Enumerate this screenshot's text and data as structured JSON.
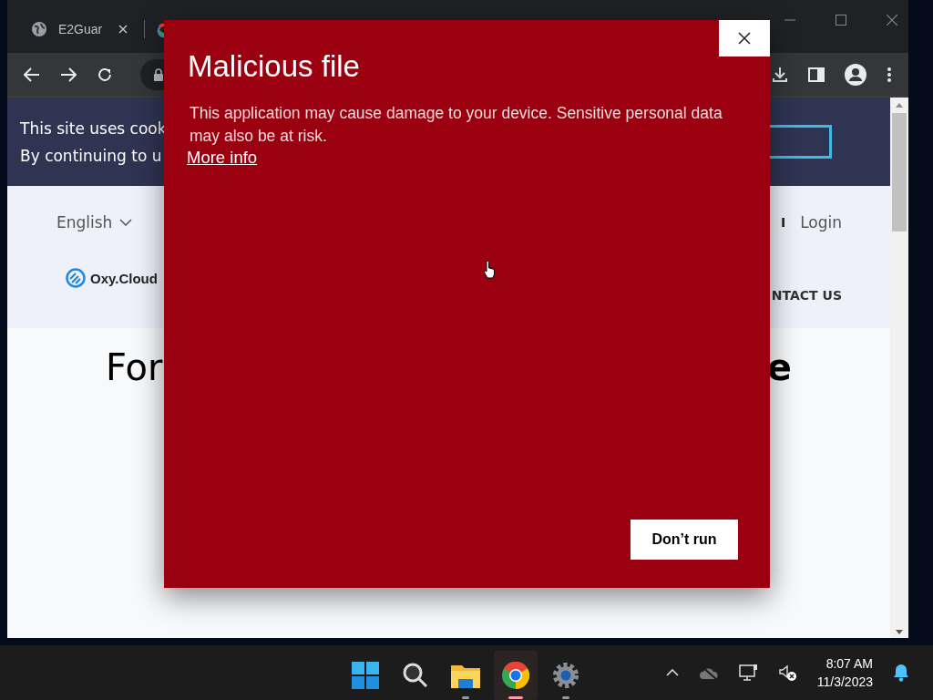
{
  "browser": {
    "tabs": [
      {
        "kind": "globe",
        "title": "E2Guar"
      },
      {
        "kind": "google"
      }
    ]
  },
  "page": {
    "cookie_banner": {
      "lines": [
        "This site uses cook",
        "By continuing to u"
      ]
    },
    "header": {
      "language": "English",
      "separator": "I",
      "login": "Login",
      "logo": "Oxy.Cloud",
      "nav_item": "NTACT US"
    },
    "heading_parts": [
      "For",
      "e"
    ]
  },
  "dialog": {
    "title": "Malicious file",
    "message": "This application may cause damage to your device. Sensitive personal data may also be at risk.",
    "link": "More info",
    "button": "Don’t run"
  },
  "taskbar": {
    "apps": [
      {
        "kind": "start",
        "selected": false
      },
      {
        "kind": "search",
        "selected": false
      },
      {
        "kind": "explorer",
        "selected": false
      },
      {
        "kind": "chrome",
        "selected": true
      },
      {
        "kind": "settings",
        "selected": false
      }
    ],
    "time": "8:07 AM",
    "date": "11/3/2023"
  }
}
